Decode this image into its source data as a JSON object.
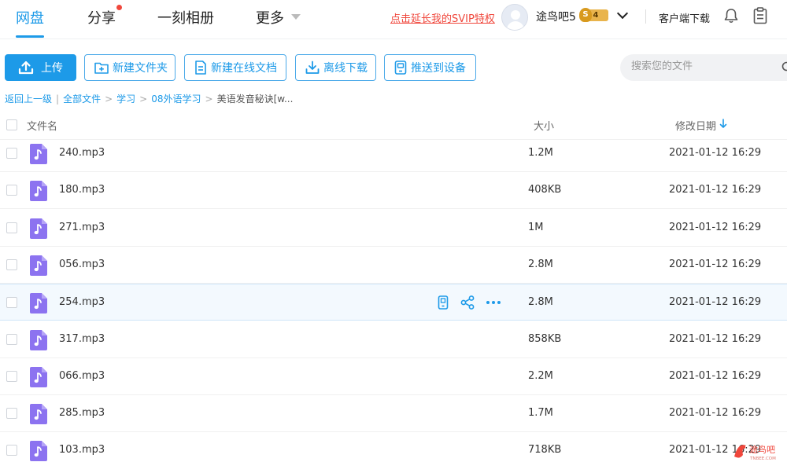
{
  "nav": {
    "tabs": [
      "网盘",
      "分享",
      "一刻相册",
      "更多"
    ],
    "svip_link": "点击延长我的SVIP特权",
    "username": "途鸟吧5",
    "vip_level": "4",
    "client_download": "客户端下载"
  },
  "toolbar": {
    "upload": "上传",
    "new_folder": "新建文件夹",
    "new_doc": "新建在线文档",
    "offline_download": "离线下载",
    "push_device": "推送到设备",
    "search_placeholder": "搜索您的文件"
  },
  "breadcrumb": {
    "back": "返回上一级",
    "all_files": "全部文件",
    "study": "学习",
    "foreign": "08外语学习",
    "current": "美语发音秘诀[w..."
  },
  "table": {
    "headers": {
      "name": "文件名",
      "size": "大小",
      "date": "修改日期"
    },
    "rows": [
      {
        "name": "240.mp3",
        "size": "1.2M",
        "date": "2021-01-12 16:29"
      },
      {
        "name": "180.mp3",
        "size": "408KB",
        "date": "2021-01-12 16:29"
      },
      {
        "name": "271.mp3",
        "size": "1M",
        "date": "2021-01-12 16:29"
      },
      {
        "name": "056.mp3",
        "size": "2.8M",
        "date": "2021-01-12 16:29"
      },
      {
        "name": "254.mp3",
        "size": "2.8M",
        "date": "2021-01-12 16:29"
      },
      {
        "name": "317.mp3",
        "size": "858KB",
        "date": "2021-01-12 16:29"
      },
      {
        "name": "066.mp3",
        "size": "2.2M",
        "date": "2021-01-12 16:29"
      },
      {
        "name": "285.mp3",
        "size": "1.7M",
        "date": "2021-01-12 16:29"
      },
      {
        "name": "103.mp3",
        "size": "718KB",
        "date": "2021-01-12 16:29"
      }
    ]
  },
  "watermark": {
    "name": "途鸟吧",
    "url": "TNBEE.COM"
  },
  "colors": {
    "accent": "#1d9ae8",
    "alert": "#f0473c",
    "audio_icon": "#8c73f0"
  }
}
